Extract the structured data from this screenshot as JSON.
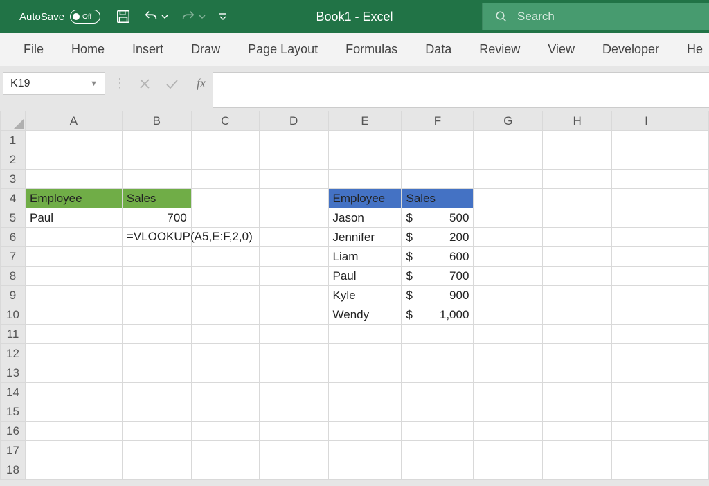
{
  "titlebar": {
    "autosave_label": "AutoSave",
    "autosave_state": "Off",
    "title": "Book1  -  Excel",
    "search_placeholder": "Search"
  },
  "ribbon": {
    "tabs": [
      "File",
      "Home",
      "Insert",
      "Draw",
      "Page Layout",
      "Formulas",
      "Data",
      "Review",
      "View",
      "Developer",
      "He"
    ]
  },
  "formulabar": {
    "namebox": "K19",
    "fx_label": "fx",
    "formula": ""
  },
  "columns": [
    "A",
    "B",
    "C",
    "D",
    "E",
    "F",
    "G",
    "H",
    "I"
  ],
  "row_count": 18,
  "left_table": {
    "headers": {
      "employee": "Employee",
      "sales": "Sales"
    },
    "rows": [
      {
        "employee": "Paul",
        "sales": "700"
      }
    ],
    "formula_cell": "=VLOOKUP(A5,E:F,2,0)"
  },
  "right_table": {
    "headers": {
      "employee": "Employee",
      "sales": "Sales"
    },
    "rows": [
      {
        "employee": "Jason",
        "sales": "500"
      },
      {
        "employee": "Jennifer",
        "sales": "200"
      },
      {
        "employee": "Liam",
        "sales": "600"
      },
      {
        "employee": "Paul",
        "sales": "700"
      },
      {
        "employee": "Kyle",
        "sales": "900"
      },
      {
        "employee": "Wendy",
        "sales": "1,000"
      }
    ],
    "currency_symbol": "$"
  }
}
